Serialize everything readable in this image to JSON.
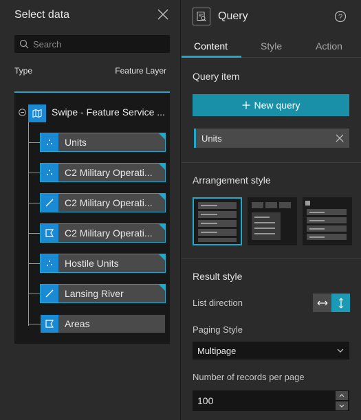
{
  "left_panel": {
    "title": "Select data",
    "search_placeholder": "Search",
    "col_type": "Type",
    "col_feature": "Feature Layer",
    "root": {
      "label": "Swipe - Feature Service ...",
      "icon": "map-icon"
    },
    "items": [
      {
        "label": "Units",
        "icon": "point-icon",
        "selected": true
      },
      {
        "label": "C2 Military Operati...",
        "icon": "point-icon",
        "selected": true
      },
      {
        "label": "C2 Military Operati...",
        "icon": "polyline-icon",
        "selected": true
      },
      {
        "label": "C2 Military Operati...",
        "icon": "polygon-icon",
        "selected": true
      },
      {
        "label": "Hostile Units",
        "icon": "point-icon",
        "selected": true
      },
      {
        "label": "Lansing River",
        "icon": "polyline-icon",
        "selected": true
      },
      {
        "label": "Areas",
        "icon": "polygon-icon",
        "selected": false
      }
    ]
  },
  "right_panel": {
    "title": "Query",
    "tabs": [
      "Content",
      "Style",
      "Action"
    ],
    "active_tab": "Content",
    "query_item_heading": "Query item",
    "new_query_label": "New query",
    "query_items": [
      "Units"
    ],
    "arrangement_heading": "Arrangement style",
    "result_style_heading": "Result style",
    "list_direction_label": "List direction",
    "paging_style_label": "Paging Style",
    "paging_style_value": "Multipage",
    "records_label": "Number of records per page",
    "records_value": "100"
  },
  "colors": {
    "accent": "#1ea9cc",
    "primary_button": "#1a8fa8",
    "layer_icon": "#1a8ad4"
  }
}
